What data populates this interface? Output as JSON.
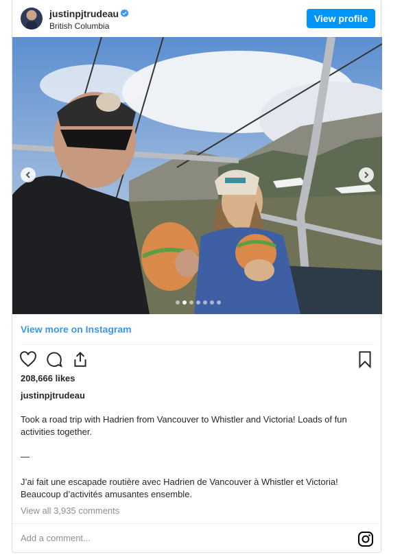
{
  "header": {
    "username": "justinpjtrudeau",
    "location": "British Columbia",
    "view_profile_label": "View profile",
    "verified_color": "#3897f0"
  },
  "post": {
    "carousel_total": 7,
    "carousel_active": 2,
    "view_more_label": "View more on Instagram",
    "likes": "208,666 likes",
    "author": "justinpjtrudeau",
    "caption_en": "Took a road trip with Hadrien from Vancouver to Whistler and Victoria! Loads of fun activities together.",
    "caption_separator": "—",
    "caption_fr": "J’ai fait une escapade routière avec Hadrien de Vancouver à Whistler et Victoria! Beaucoup d’activités amusantes ensemble.",
    "view_all_comments": "View all 3,935 comments"
  },
  "comment": {
    "placeholder": "Add a comment..."
  },
  "colors": {
    "accent": "#0095f6",
    "link": "#3897f0",
    "text": "#262626",
    "muted": "#8e8e8e"
  },
  "icons": [
    "verified-icon",
    "heart-icon",
    "comment-icon",
    "share-icon",
    "bookmark-icon",
    "instagram-icon",
    "chevron-left-icon",
    "chevron-right-icon"
  ]
}
